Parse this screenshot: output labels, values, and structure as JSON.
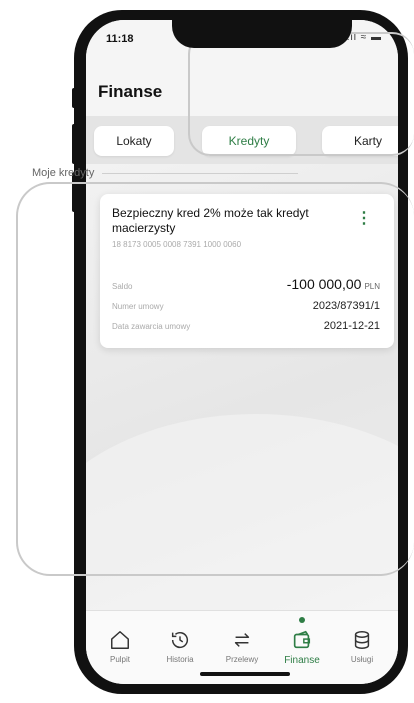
{
  "status_bar": {
    "time": "11:18",
    "icons": "..il ≈ ▬"
  },
  "header": {
    "title": "Finanse"
  },
  "tabs": [
    {
      "label": "Lokaty"
    },
    {
      "label": "Kredyty",
      "active": true
    },
    {
      "label": "Karty"
    }
  ],
  "section": {
    "label": "Moje kredyty"
  },
  "credit_card": {
    "title": "Bezpieczny kred 2% może tak kredyt macierzysty",
    "account_number": "18 8173 0005 0008 7391 1000 0060",
    "saldo_label": "Saldo",
    "saldo_value": "-100 000,00",
    "saldo_currency": "PLN",
    "contract_label": "Numer umowy",
    "contract_value": "2023/87391/1",
    "date_label": "Data zawarcia umowy",
    "date_value": "2021-12-21"
  },
  "bottom_nav": [
    {
      "label": "Pulpit",
      "icon": "home-icon"
    },
    {
      "label": "Historia",
      "icon": "history-icon"
    },
    {
      "label": "Przelewy",
      "icon": "transfer-icon"
    },
    {
      "label": "Finanse",
      "icon": "finance-icon",
      "active": true
    },
    {
      "label": "Usługi",
      "icon": "services-icon"
    }
  ],
  "colors": {
    "accent": "#2e7d45",
    "background": "#ededed",
    "card": "#ffffff"
  }
}
